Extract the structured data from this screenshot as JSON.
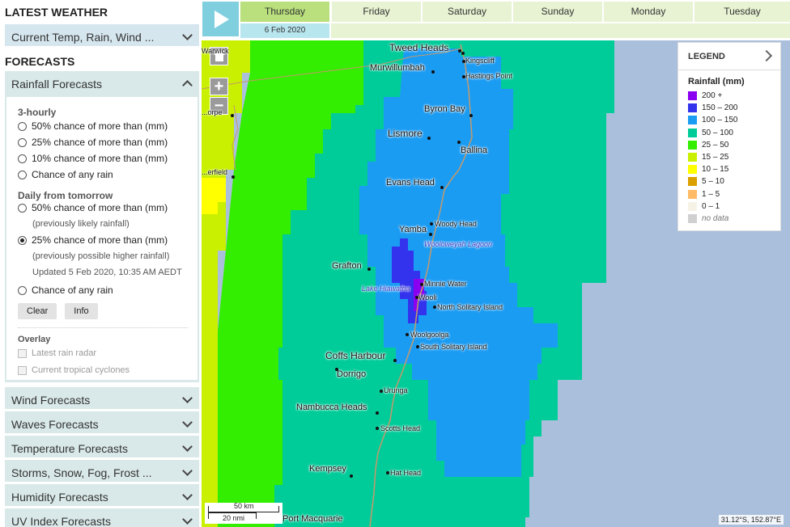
{
  "sidebar": {
    "latest_heading": "LATEST WEATHER",
    "latest_item": "Current Temp, Rain, Wind ...",
    "forecasts_heading": "FORECASTS",
    "rainfall_heading": "Rainfall Forecasts",
    "three_hourly_title": "3-hourly",
    "three_hourly": [
      "50% chance of more than (mm)",
      "25% chance of more than (mm)",
      "10% chance of more than (mm)",
      "Chance of any rain"
    ],
    "daily_title": "Daily from tomorrow",
    "daily_1": "50% chance of more than (mm)",
    "daily_1_note": "(previously likely rainfall)",
    "daily_2": "25% chance of more than (mm)",
    "daily_2_note": "(previously possible higher rainfall)",
    "updated": "Updated 5 Feb 2020, 10:35 AM AEDT",
    "daily_3": "Chance of any rain",
    "clear_label": "Clear",
    "info_label": "Info",
    "overlay_title": "Overlay",
    "overlay_1": "Latest rain radar",
    "overlay_2": "Current tropical cyclones",
    "sections": [
      "Wind Forecasts",
      "Waves Forecasts",
      "Temperature Forecasts",
      "Storms, Snow, Fog, Frost ...",
      "Humidity Forecasts",
      "UV Index Forecasts"
    ]
  },
  "days": [
    "Thursday",
    "Friday",
    "Saturday",
    "Sunday",
    "Monday",
    "Tuesday"
  ],
  "selected_date": "6 Feb 2020",
  "map": {
    "places": {
      "tweed": "Tweed Heads",
      "kingscliff": "Kingscliff",
      "murwillumbah": "Murwillumbah",
      "hastings": "Hastings Point",
      "byron": "Byron Bay",
      "lismore": "Lismore",
      "ballina": "Ballina",
      "evans": "Evans Head",
      "woody": "Woody Head",
      "yamba": "Yamba",
      "wooloweyah": "Wooloweyah Lagoon",
      "grafton": "Grafton",
      "hiawatha": "Lake Hiawatha",
      "minnie": "Minnie Water",
      "wooli": "Wooli",
      "nsolitary": "North Solitary Island",
      "woolgoolga": "Woolgoolga",
      "ssolitary": "South Solitary Island",
      "coffs": "Coffs Harbour",
      "dorrigo": "Dorrigo",
      "urunga": "Urunga",
      "nambucca": "Nambucca Heads",
      "scotts": "Scotts Head",
      "kempsey": "Kempsey",
      "hat": "Hat Head",
      "portmac": "Port Macquarie",
      "warwick": "Warwick",
      "stanthorpe": "...orpe",
      "tenterfield": "...erfield"
    },
    "scale_km": "50 km",
    "scale_nmi": "20 nmi",
    "coordinates": "31.12°S, 152.87°E"
  },
  "legend": {
    "header": "LEGEND",
    "title": "Rainfall (mm)",
    "items": [
      {
        "label": "200 +",
        "color": "#8a00f0"
      },
      {
        "label": "150 – 200",
        "color": "#3333ee"
      },
      {
        "label": "100 – 150",
        "color": "#1b9cf3"
      },
      {
        "label": "50 – 100",
        "color": "#00cc99"
      },
      {
        "label": "25 – 50",
        "color": "#33ee00"
      },
      {
        "label": "15 – 25",
        "color": "#c8f000"
      },
      {
        "label": "10 – 15",
        "color": "#ffff00"
      },
      {
        "label": "5 – 10",
        "color": "#d9a000"
      },
      {
        "label": "1 – 5",
        "color": "#ffbb66"
      },
      {
        "label": "0 – 1",
        "color": "#f6f3e6"
      },
      {
        "label": "no data",
        "color": "#d0d0d0"
      }
    ]
  }
}
